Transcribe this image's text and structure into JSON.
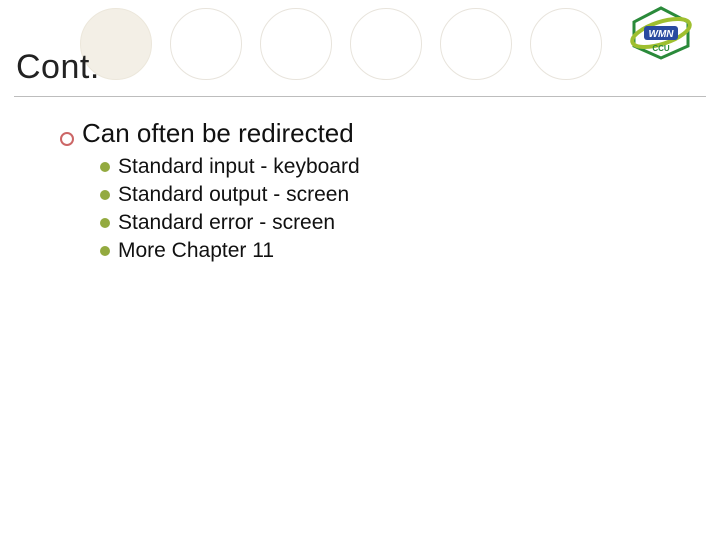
{
  "title": "Cont.",
  "logo": {
    "label_top": "WMN",
    "label_bottom": "CCU"
  },
  "main": {
    "bullet_text": "Can often be redirected",
    "sub_items": [
      "Standard input - keyboard",
      "Standard output - screen",
      "Standard error - screen",
      "More Chapter 11"
    ]
  }
}
